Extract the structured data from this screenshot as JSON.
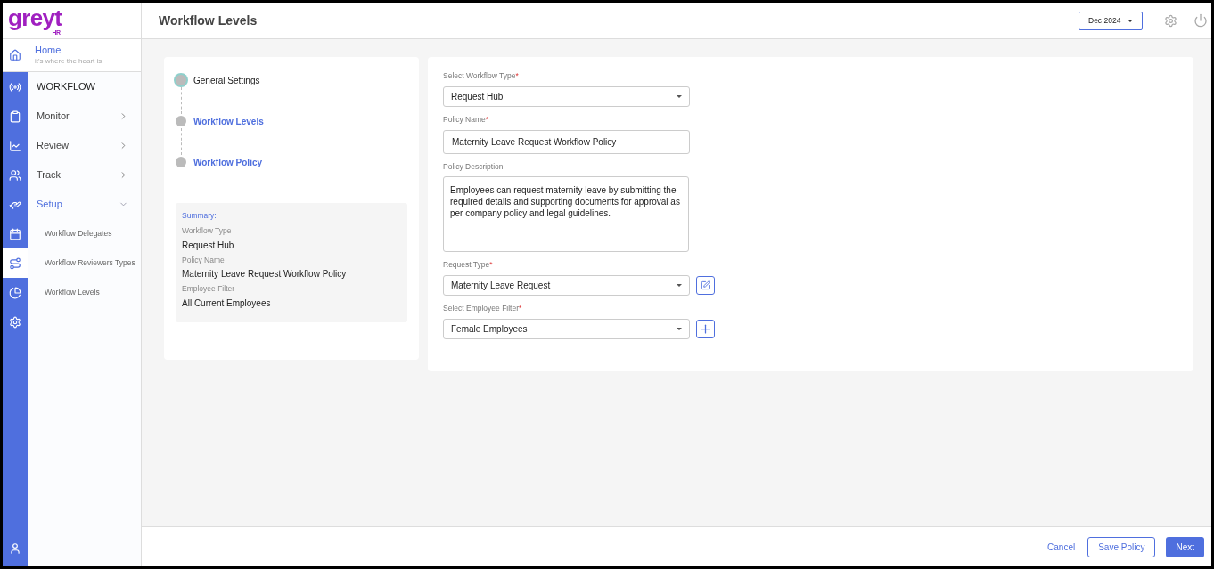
{
  "logo": {
    "text": "greyt",
    "sub": "HR"
  },
  "header": {
    "title": "Workflow Levels",
    "period": "Dec 2024"
  },
  "home": {
    "label": "Home",
    "tagline": "it's where the heart is!"
  },
  "rail": [
    {
      "kind": "broadcast",
      "selected": false
    },
    {
      "kind": "clipboard",
      "selected": false
    },
    {
      "kind": "chart",
      "selected": false
    },
    {
      "kind": "people",
      "selected": false
    },
    {
      "kind": "hand",
      "selected": false
    },
    {
      "kind": "calendar",
      "selected": false
    },
    {
      "kind": "route",
      "selected": true
    },
    {
      "kind": "pie",
      "selected": false
    },
    {
      "kind": "gear",
      "selected": false
    }
  ],
  "sidebar": {
    "section": "WORKFLOW",
    "items": [
      {
        "label": "Monitor",
        "expanded": false
      },
      {
        "label": "Review",
        "expanded": false
      },
      {
        "label": "Track",
        "expanded": false
      },
      {
        "label": "Setup",
        "expanded": true,
        "children": [
          {
            "label": "Workflow Delegates"
          },
          {
            "label": "Workflow Reviewers Types"
          },
          {
            "label": "Workflow Levels"
          }
        ]
      }
    ]
  },
  "steps": [
    {
      "label": "General Settings",
      "selected": true
    },
    {
      "label": "Workflow Levels",
      "selected": false
    },
    {
      "label": "Workflow Policy",
      "selected": false
    }
  ],
  "summary": {
    "title": "Summary:",
    "fields": [
      {
        "label": "Workflow Type",
        "value": "Request Hub"
      },
      {
        "label": "Policy Name",
        "value": "Maternity Leave Request Workflow Policy"
      },
      {
        "label": "Employee Filter",
        "value": "All Current Employees"
      }
    ]
  },
  "form": [
    {
      "kind": "select",
      "label": "Select Workflow Type",
      "required_mark": "*",
      "value": "Request Hub"
    },
    {
      "kind": "text",
      "label": "Policy Name",
      "required_mark": "*",
      "value": "Maternity Leave Request Workflow Policy"
    },
    {
      "kind": "textarea",
      "label": "Policy Description",
      "value": "Employees can request maternity leave by submitting the required details and supporting documents for approval as per company policy and legal guidelines."
    },
    {
      "kind": "select",
      "label": "Request Type",
      "required_mark": "*",
      "value": "Maternity Leave Request",
      "button": {
        "kind": "edit"
      }
    },
    {
      "kind": "select",
      "label": "Select Employee Filter",
      "required_mark": "*",
      "value": "Female Employees",
      "button": {
        "kind": "add"
      }
    }
  ],
  "footer": {
    "cancel": "Cancel",
    "save": "Save Policy",
    "next": "Next"
  }
}
